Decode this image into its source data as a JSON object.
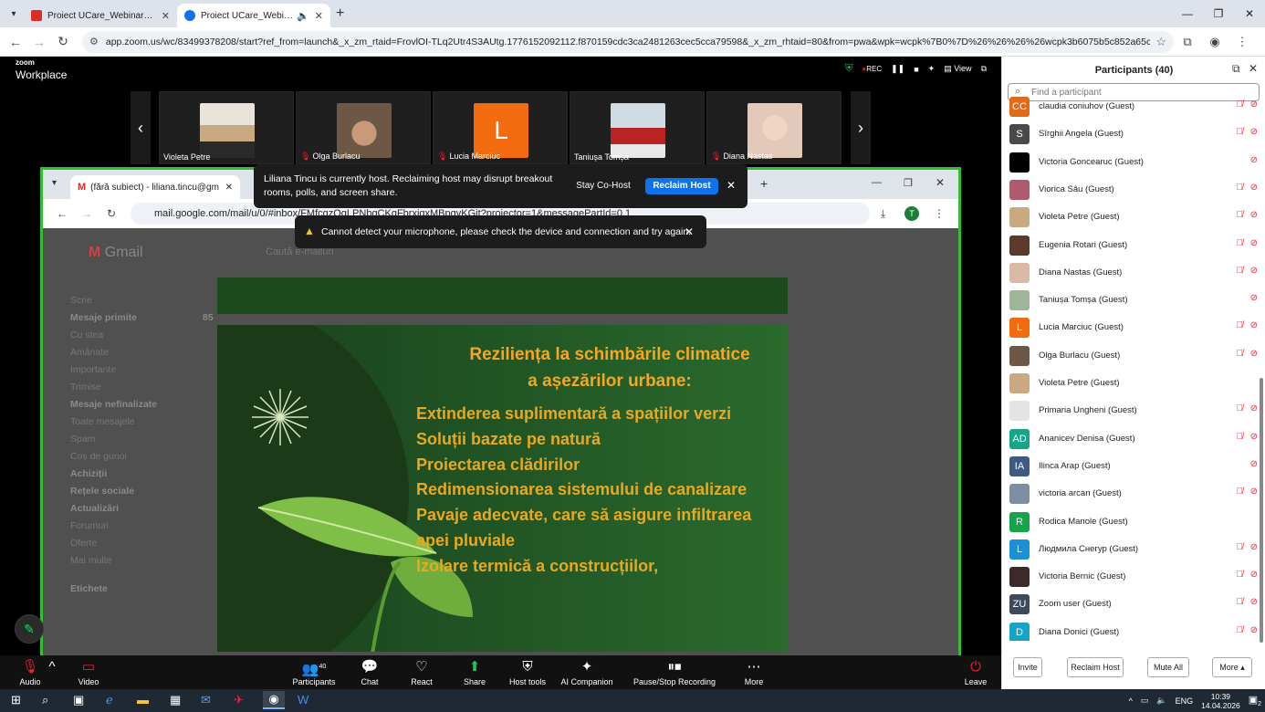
{
  "browser": {
    "tabs": [
      {
        "title": "Proiect UCare_Webinare_14.04....",
        "active": false,
        "fav_color": "#d93025"
      },
      {
        "title": "Proiect UCare_Webinar #1_",
        "active": true,
        "fav_color": "#0e72ed"
      }
    ],
    "url": "app.zoom.us/wc/83499378208/start?ref_from=launch&_x_zm_rtaid=FrovlOI-TLq2Utr4S3AUtg.1776152092112.f870159cdc3ca2481263cec5cca79598&_x_zm_rhtaid=80&from=pwa&wpk=wcpk%7B0%7D%26%26%26%26wcpk3b6075b5c852a65c9f67f4116f..."
  },
  "zoom": {
    "logo_small": "zoom",
    "logo_big": "Workplace",
    "rec_label": "REC",
    "view_label": "View",
    "thumbnails": [
      {
        "name": "Violeta Petre",
        "muted": false,
        "color": "#c9a982"
      },
      {
        "name": "Olga Burlacu",
        "muted": true,
        "color": "#6d5846"
      },
      {
        "name": "Lucia Marciuc",
        "muted": true,
        "letter": "L"
      },
      {
        "name": "Taniușa Tomșa",
        "muted": false,
        "color": "#c8d6dd"
      },
      {
        "name": "Diana Nastas",
        "muted": true,
        "color": "#e8c7b4"
      }
    ],
    "host_popup": {
      "message": "Liliana Tincu is currently host. Reclaiming host may disrupt breakout rooms, polls, and screen share.",
      "stay_label": "Stay Co-Host",
      "reclaim_label": "Reclaim Host"
    },
    "mic_warning": "Cannot detect your microphone, please check the device and connection and try again.",
    "toolbar": {
      "audio": "Audio",
      "video": "Video",
      "participants": "Participants",
      "participants_count": "40",
      "chat": "Chat",
      "react": "React",
      "share": "Share",
      "host_tools": "Host tools",
      "ai_companion": "AI Companion",
      "recording": "Pause/Stop Recording",
      "more": "More",
      "leave": "Leave"
    }
  },
  "shared_screen": {
    "tab_title": "(fără subiect) - liliana.tincu@gm",
    "url": "mail.google.com/mail/u/0/#inbox/FMfcgzQgLPNbgCKgFbrxjqxMBpgvKGjt?projector=1&messagePartId=0.1",
    "gmail_logo": "Gmail",
    "search_placeholder": "Caută e-mailuri",
    "sidebar": [
      "Scrie",
      "Mesaje primite",
      "Cu stea",
      "Amânate",
      "Importante",
      "Trimise",
      "Mesaje nefinalizate",
      "Toate mesajele",
      "Spam",
      "Coș de gunoi",
      "Achiziții",
      "Rețele sociale",
      "Actualizări",
      "Forumuri",
      "Oferte",
      "Mai multe",
      "Etichete"
    ],
    "inbox_count": "85",
    "slide": {
      "title": "Reziliența la schimbările climatice a așezărilor urbane:",
      "items": [
        "Extinderea suplimentară a spațiilor verzi",
        "Soluții bazate pe natură",
        "Proiectarea clădirilor",
        "Redimensionarea sistemului de canalizare",
        "Pavaje adecvate, care să asigure infiltrarea",
        "apei pluviale",
        "Izolare termică a construcțiilor,"
      ]
    }
  },
  "participants": {
    "title": "Participants (40)",
    "search_placeholder": "Find a participant",
    "list": [
      {
        "name": "claudia coniuhov (Guest)",
        "initials": "CC",
        "color": "#e26a1b",
        "mic": true,
        "cam": true
      },
      {
        "name": "Sîrghii Angela (Guest)",
        "initials": "S",
        "color": "#4a4a4a",
        "mic": true,
        "cam": true
      },
      {
        "name": "Victoria Goncearuc (Guest)",
        "initials": "",
        "color": "#000000",
        "mic": false,
        "cam": true
      },
      {
        "name": "Viorica Sâu (Guest)",
        "initials": "",
        "color": "#b05a6e",
        "mic": true,
        "cam": true
      },
      {
        "name": "Violeta Petre (Guest)",
        "initials": "",
        "color": "#c9a982",
        "mic": true,
        "cam": true
      },
      {
        "name": "Eugenia Rotari (Guest)",
        "initials": "",
        "color": "#5c3a2b",
        "mic": true,
        "cam": true
      },
      {
        "name": "Diana Nastas (Guest)",
        "initials": "",
        "color": "#d9b9a6",
        "mic": true,
        "cam": true
      },
      {
        "name": "Taniușa Tomșa (Guest)",
        "initials": "",
        "color": "#9fb59a",
        "mic": false,
        "cam": true
      },
      {
        "name": "Lucia Marciuc (Guest)",
        "initials": "L",
        "color": "#f26b0f",
        "mic": true,
        "cam": true
      },
      {
        "name": "Olga Burlacu (Guest)",
        "initials": "",
        "color": "#6d5846",
        "mic": true,
        "cam": true
      },
      {
        "name": "Violeta Petre (Guest)",
        "initials": "",
        "color": "#c9a982",
        "mic": false,
        "cam": false
      },
      {
        "name": "Primaria Ungheni (Guest)",
        "initials": "",
        "color": "#e4e4e4",
        "mic": true,
        "cam": true
      },
      {
        "name": "Ananicev Denisa (Guest)",
        "initials": "AD",
        "color": "#17a589",
        "mic": true,
        "cam": true
      },
      {
        "name": "Ilinca Arap (Guest)",
        "initials": "IA",
        "color": "#3d5a80",
        "mic": false,
        "cam": true
      },
      {
        "name": "victoria arcan (Guest)",
        "initials": "",
        "color": "#7d8fa3",
        "mic": true,
        "cam": true
      },
      {
        "name": "Rodica Manole (Guest)",
        "initials": "R",
        "color": "#16a34a",
        "mic": false,
        "cam": false
      },
      {
        "name": "Людмила Снегур (Guest)",
        "initials": "L",
        "color": "#1d8fd6",
        "mic": true,
        "cam": true
      },
      {
        "name": "Victoria Bernic (Guest)",
        "initials": "",
        "color": "#3b2a2a",
        "mic": true,
        "cam": true
      },
      {
        "name": "Zoom user (Guest)",
        "initials": "ZU",
        "color": "#3d4a5c",
        "mic": true,
        "cam": true
      },
      {
        "name": "Diana Donici (Guest)",
        "initials": "D",
        "color": "#1aa3c8",
        "mic": true,
        "cam": true
      }
    ],
    "buttons": [
      "Invite",
      "Reclaim Host",
      "Mute All",
      "More ▴"
    ]
  },
  "taskbar": {
    "lang": "ENG",
    "time": "10:39",
    "date": "14.04.2026",
    "notif": "2"
  }
}
